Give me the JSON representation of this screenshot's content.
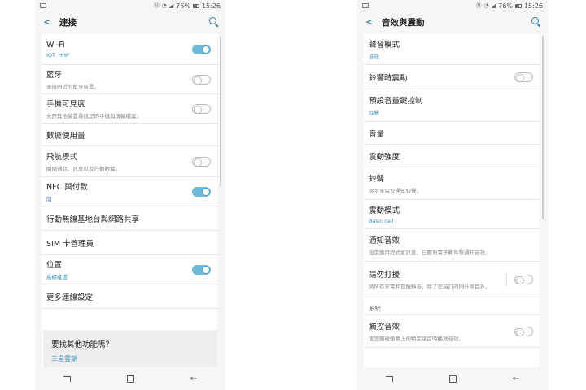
{
  "status": {
    "battery": "76%",
    "time": "15:26"
  },
  "left": {
    "title": "連接",
    "items": [
      {
        "label": "Wi-Fi",
        "sub": "IOT_HHP",
        "sub_color": "blue",
        "toggle": "on"
      },
      {
        "label": "藍牙",
        "sub": "連接附近的藍牙裝置。",
        "sub_color": "gray",
        "toggle": "off"
      },
      {
        "label": "手機可見度",
        "sub": "允許其他裝置尋找您的手機與傳輸檔案。",
        "sub_color": "gray",
        "toggle": "off"
      },
      {
        "label": "數據使用量",
        "sub": "",
        "toggle": "none"
      },
      {
        "label": "飛航模式",
        "sub": "關閉通話、訊息以及行動數據。",
        "sub_color": "gray",
        "toggle": "off"
      },
      {
        "label": "NFC 與付款",
        "sub": "開",
        "sub_color": "blue",
        "toggle": "on"
      },
      {
        "label": "行動無線基地台與網路共享",
        "sub": "",
        "toggle": "none"
      },
      {
        "label": "SIM 卡管理員",
        "sub": "",
        "toggle": "none"
      },
      {
        "label": "位置",
        "sub": "高精確度",
        "sub_color": "blue",
        "toggle": "on"
      },
      {
        "label": "更多連線設定",
        "sub": "",
        "toggle": "none"
      }
    ],
    "card": {
      "title": "要找其他功能嗎？",
      "link": "三星雲端"
    }
  },
  "right": {
    "title": "音效與震動",
    "items": [
      {
        "label": "聲音模式",
        "sub": "音效",
        "sub_color": "blue",
        "toggle": "none"
      },
      {
        "label": "鈴響時震動",
        "sub": "",
        "toggle": "off"
      },
      {
        "label": "預設音量鍵控制",
        "sub": "鈴聲",
        "sub_color": "blue",
        "toggle": "none"
      },
      {
        "label": "音量",
        "sub": "",
        "toggle": "none"
      },
      {
        "label": "震動強度",
        "sub": "",
        "toggle": "none"
      },
      {
        "label": "鈴聲",
        "sub": "設定來電及通知鈴聲。",
        "sub_color": "gray",
        "toggle": "none"
      },
      {
        "label": "震動模式",
        "sub": "Basic call",
        "sub_color": "blue",
        "toggle": "none"
      },
      {
        "label": "通知音效",
        "sub": "設定應用程式如訊息、日曆與電子郵件等通知音效。",
        "sub_color": "gray",
        "toggle": "none"
      },
      {
        "label": "請勿打擾",
        "sub": "將所有來電和提醒靜音，除了您自訂的例外項目外。",
        "sub_color": "gray",
        "toggle": "off",
        "divider": true
      }
    ],
    "section": "系統",
    "items2": [
      {
        "label": "觸控音效",
        "sub": "當您觸碰螢幕上的特定項目時播放音效。",
        "sub_color": "gray",
        "toggle": "off"
      }
    ]
  }
}
